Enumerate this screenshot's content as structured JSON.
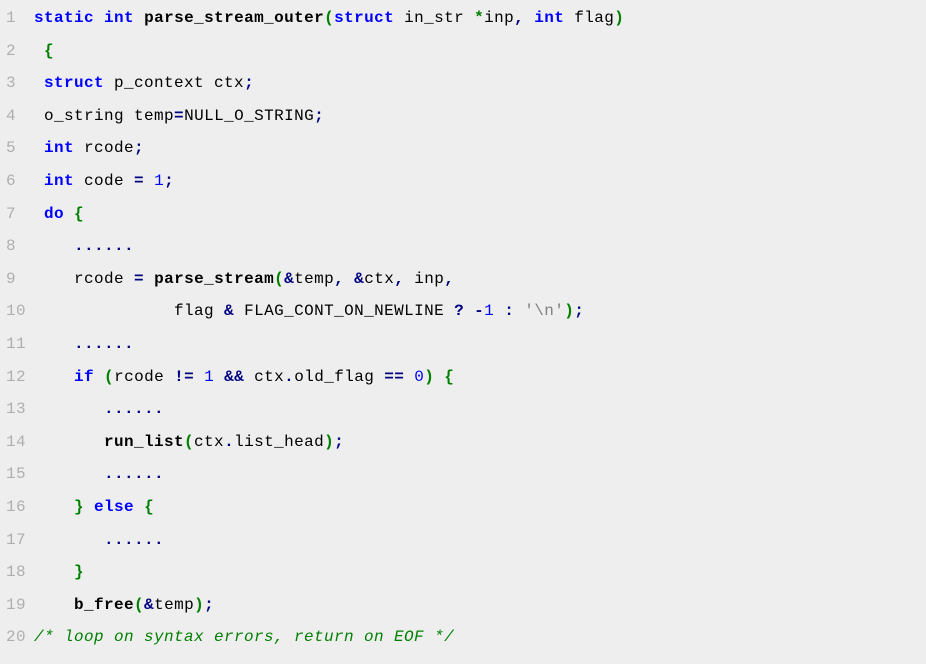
{
  "code": {
    "lines": [
      {
        "num": "1",
        "indent": "",
        "tokens": [
          [
            "kw",
            "static"
          ],
          [
            "plain",
            " "
          ],
          [
            "kw",
            "int"
          ],
          [
            "plain",
            " "
          ],
          [
            "fn",
            "parse_stream_outer"
          ],
          [
            "opp",
            "("
          ],
          [
            "kw",
            "struct"
          ],
          [
            "plain",
            " in_str "
          ],
          [
            "opp",
            "*"
          ],
          [
            "plain",
            "inp"
          ],
          [
            "op",
            ","
          ],
          [
            "plain",
            " "
          ],
          [
            "kw",
            "int"
          ],
          [
            "plain",
            " flag"
          ],
          [
            "opp",
            ")"
          ]
        ]
      },
      {
        "num": "2",
        "indent": " ",
        "tokens": [
          [
            "opp",
            "{"
          ]
        ]
      },
      {
        "num": "3",
        "indent": " ",
        "tokens": [
          [
            "kw",
            "struct"
          ],
          [
            "plain",
            " p_context ctx"
          ],
          [
            "op",
            ";"
          ]
        ]
      },
      {
        "num": "4",
        "indent": " ",
        "tokens": [
          [
            "plain",
            "o_string temp"
          ],
          [
            "op",
            "="
          ],
          [
            "plain",
            "NULL_O_STRING"
          ],
          [
            "op",
            ";"
          ]
        ]
      },
      {
        "num": "5",
        "indent": " ",
        "tokens": [
          [
            "kw",
            "int"
          ],
          [
            "plain",
            " rcode"
          ],
          [
            "op",
            ";"
          ]
        ]
      },
      {
        "num": "6",
        "indent": " ",
        "tokens": [
          [
            "kw",
            "int"
          ],
          [
            "plain",
            " code "
          ],
          [
            "op",
            "="
          ],
          [
            "plain",
            " "
          ],
          [
            "num",
            "1"
          ],
          [
            "op",
            ";"
          ]
        ]
      },
      {
        "num": "7",
        "indent": " ",
        "tokens": [
          [
            "kw",
            "do"
          ],
          [
            "plain",
            " "
          ],
          [
            "opp",
            "{"
          ]
        ]
      },
      {
        "num": "8",
        "indent": "    ",
        "tokens": [
          [
            "op",
            "......"
          ]
        ]
      },
      {
        "num": "9",
        "indent": "    ",
        "tokens": [
          [
            "plain",
            "rcode "
          ],
          [
            "op",
            "="
          ],
          [
            "plain",
            " "
          ],
          [
            "fn",
            "parse_stream"
          ],
          [
            "opp",
            "("
          ],
          [
            "op",
            "&"
          ],
          [
            "plain",
            "temp"
          ],
          [
            "op",
            ","
          ],
          [
            "plain",
            " "
          ],
          [
            "op",
            "&"
          ],
          [
            "plain",
            "ctx"
          ],
          [
            "op",
            ","
          ],
          [
            "plain",
            " inp"
          ],
          [
            "op",
            ","
          ]
        ]
      },
      {
        "num": "10",
        "indent": "              ",
        "tokens": [
          [
            "plain",
            "flag "
          ],
          [
            "op",
            "&"
          ],
          [
            "plain",
            " FLAG_CONT_ON_NEWLINE "
          ],
          [
            "op",
            "?"
          ],
          [
            "plain",
            " "
          ],
          [
            "op",
            "-"
          ],
          [
            "num",
            "1"
          ],
          [
            "plain",
            " "
          ],
          [
            "op",
            ":"
          ],
          [
            "plain",
            " "
          ],
          [
            "str",
            "'\\n'"
          ],
          [
            "opp",
            ")"
          ],
          [
            "op",
            ";"
          ]
        ]
      },
      {
        "num": "11",
        "indent": "    ",
        "tokens": [
          [
            "op",
            "......"
          ]
        ]
      },
      {
        "num": "12",
        "indent": "    ",
        "tokens": [
          [
            "kw",
            "if"
          ],
          [
            "plain",
            " "
          ],
          [
            "opp",
            "("
          ],
          [
            "plain",
            "rcode "
          ],
          [
            "op",
            "!="
          ],
          [
            "plain",
            " "
          ],
          [
            "num",
            "1"
          ],
          [
            "plain",
            " "
          ],
          [
            "op",
            "&&"
          ],
          [
            "plain",
            " ctx"
          ],
          [
            "op",
            "."
          ],
          [
            "plain",
            "old_flag "
          ],
          [
            "op",
            "=="
          ],
          [
            "plain",
            " "
          ],
          [
            "num",
            "0"
          ],
          [
            "opp",
            ")"
          ],
          [
            "plain",
            " "
          ],
          [
            "opp",
            "{"
          ]
        ]
      },
      {
        "num": "13",
        "indent": "       ",
        "tokens": [
          [
            "op",
            "......"
          ]
        ]
      },
      {
        "num": "14",
        "indent": "       ",
        "tokens": [
          [
            "fn",
            "run_list"
          ],
          [
            "opp",
            "("
          ],
          [
            "plain",
            "ctx"
          ],
          [
            "op",
            "."
          ],
          [
            "plain",
            "list_head"
          ],
          [
            "opp",
            ")"
          ],
          [
            "op",
            ";"
          ]
        ]
      },
      {
        "num": "15",
        "indent": "       ",
        "tokens": [
          [
            "op",
            "......"
          ]
        ]
      },
      {
        "num": "16",
        "indent": "    ",
        "tokens": [
          [
            "opp",
            "}"
          ],
          [
            "plain",
            " "
          ],
          [
            "kw",
            "else"
          ],
          [
            "plain",
            " "
          ],
          [
            "opp",
            "{"
          ]
        ]
      },
      {
        "num": "17",
        "indent": "       ",
        "tokens": [
          [
            "op",
            "......"
          ]
        ]
      },
      {
        "num": "18",
        "indent": "    ",
        "tokens": [
          [
            "opp",
            "}"
          ]
        ]
      },
      {
        "num": "19",
        "indent": "    ",
        "tokens": [
          [
            "fn",
            "b_free"
          ],
          [
            "opp",
            "("
          ],
          [
            "op",
            "&"
          ],
          [
            "plain",
            "temp"
          ],
          [
            "opp",
            ")"
          ],
          [
            "op",
            ";"
          ]
        ]
      },
      {
        "num": "20",
        "indent": "",
        "tokens": [
          [
            "cmt",
            "/* loop on syntax errors, return on EOF */"
          ]
        ]
      }
    ]
  }
}
